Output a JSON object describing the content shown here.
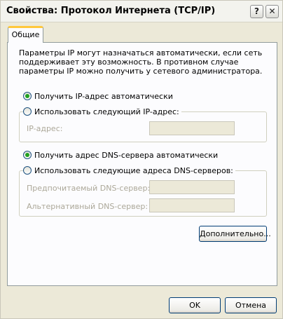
{
  "window": {
    "title": "Свойства: Протокол Интернета (TCP/IP)",
    "help_button": "?",
    "close_button": "✕"
  },
  "tabs": [
    {
      "label": "Общие",
      "active": true
    }
  ],
  "description": "Параметры IP могут назначаться автоматически, если сеть поддерживает эту возможность. В противном случае параметры IP можно получить у сетевого администратора.",
  "ip_section": {
    "auto_option": {
      "label": "Получить IP-адрес автоматически",
      "checked": true
    },
    "manual_option": {
      "label": "Использовать следующий IP-адрес:",
      "checked": false
    },
    "ip_address_label": "IP-адрес:",
    "ip_address_value": ""
  },
  "dns_section": {
    "auto_option": {
      "label": "Получить адрес DNS-сервера автоматически",
      "checked": true
    },
    "manual_option": {
      "label": "Использовать следующие адреса DNS-серверов:",
      "checked": false
    },
    "preferred_label": "Предпочитаемый DNS-сервер:",
    "preferred_value": "",
    "alternate_label": "Альтернативный DNS-сервер:",
    "alternate_value": ""
  },
  "advanced_button": "Дополнительно...",
  "footer": {
    "ok_button": "OK",
    "cancel_button": "Отмена"
  },
  "colors": {
    "dialog_background": "#ece9d8",
    "panel_background": "#fcfcfe",
    "tab_highlight": "#ffc83c",
    "radio_checked": "#21a121",
    "disabled_text": "#aca899"
  }
}
